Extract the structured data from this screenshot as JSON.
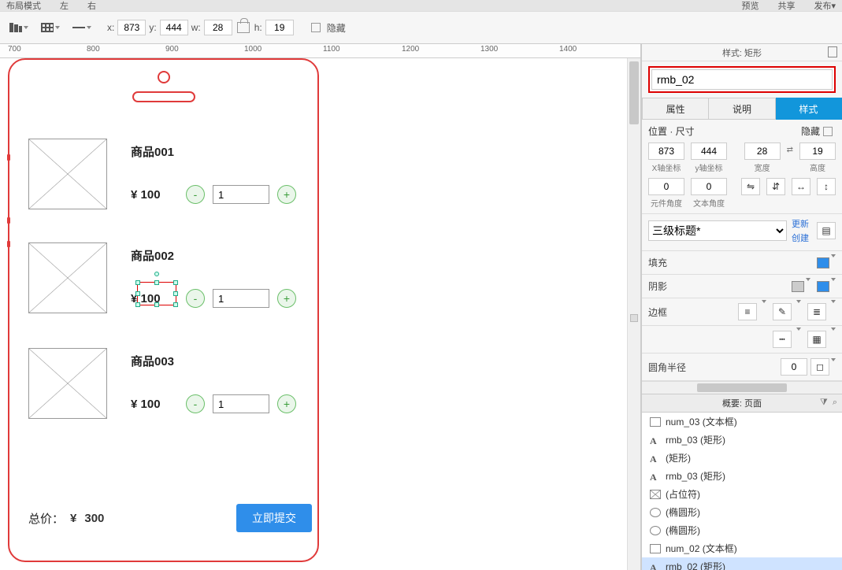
{
  "menubar": {
    "left": [
      "布局模式",
      "左",
      "右"
    ],
    "right": [
      "预览",
      "共享",
      "发布▾"
    ]
  },
  "toolbar": {
    "x_label": "x:",
    "x": "873",
    "y_label": "y:",
    "y": "444",
    "w_label": "w:",
    "w": "28",
    "h_label": "h:",
    "h": "19",
    "hide_label": "隐藏"
  },
  "ruler_ticks": [
    "700",
    "800",
    "900",
    "1000",
    "1100",
    "1200",
    "1300",
    "1400"
  ],
  "phone": {
    "products": [
      {
        "title": "商品001",
        "price": "¥ 100",
        "qty": "1"
      },
      {
        "title": "商品002",
        "price": "¥ 100",
        "qty": "1"
      },
      {
        "title": "商品003",
        "price": "¥ 100",
        "qty": "1"
      }
    ],
    "footer": {
      "label": "总价：",
      "currency": "¥",
      "total": "300",
      "submit": "立即提交"
    }
  },
  "inspector": {
    "panel_title": "样式: 矩形",
    "name": "rmb_02",
    "tabs": [
      "属性",
      "说明",
      "样式"
    ],
    "section_pos_title": "位置 · 尺寸",
    "hide_label": "隐藏",
    "pos": {
      "x": "873",
      "y": "444",
      "w": "28",
      "h": "19",
      "x_cap": "X轴坐标",
      "y_cap": "y轴坐标",
      "w_cap": "宽度",
      "h_cap": "高度"
    },
    "angles": {
      "el": "0",
      "txt": "0",
      "el_cap": "元件角度",
      "txt_cap": "文本角度"
    },
    "style_select": "三级标题*",
    "links": [
      "更新",
      "创建"
    ],
    "fill": "填充",
    "shadow": "阴影",
    "border": "边框",
    "radius": "圆角半径",
    "radius_val": "0",
    "outline_title": "概要: 页面",
    "outline": [
      {
        "icon": "rect",
        "label": "num_03 (文本框)"
      },
      {
        "icon": "A",
        "label": "rmb_03 (矩形)"
      },
      {
        "icon": "A",
        "label": "(矩形)"
      },
      {
        "icon": "A",
        "label": "rmb_03 (矩形)"
      },
      {
        "icon": "place",
        "label": "(占位符)"
      },
      {
        "icon": "circ",
        "label": "(椭圆形)"
      },
      {
        "icon": "circ",
        "label": "(椭圆形)"
      },
      {
        "icon": "rect",
        "label": "num_02 (文本框)"
      },
      {
        "icon": "A",
        "label": "rmb_02 (矩形)",
        "selected": true
      }
    ]
  }
}
